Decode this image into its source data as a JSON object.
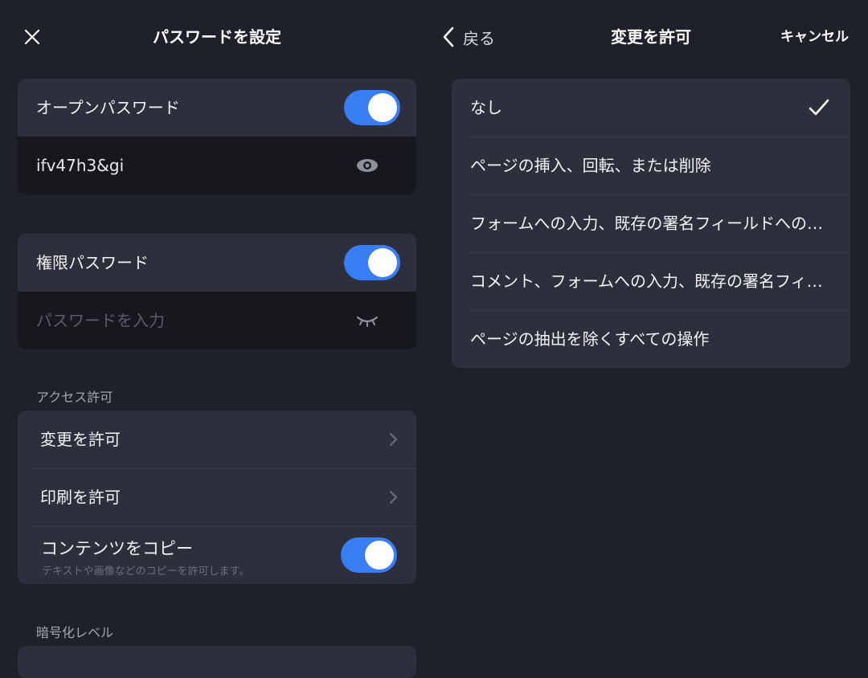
{
  "left": {
    "title": "パスワードを設定",
    "open_password": {
      "label": "オープンパスワード",
      "enabled": true,
      "value": "ifv47h3&gi"
    },
    "permission_password": {
      "label": "権限パスワード",
      "enabled": true,
      "placeholder": "パスワードを入力"
    },
    "access": {
      "section_label": "アクセス許可",
      "allow_changes_label": "変更を許可",
      "allow_printing_label": "印刷を許可",
      "copy_content": {
        "label": "コンテンツをコピー",
        "description": "テキストや画像などのコピーを許可します。",
        "enabled": true
      }
    },
    "encryption_section_label": "暗号化レベル"
  },
  "right": {
    "back_label": "戻る",
    "title": "変更を許可",
    "cancel_label": "キャンセル",
    "options": [
      {
        "label": "なし",
        "selected": true
      },
      {
        "label": "ページの挿入、回転、または削除",
        "selected": false
      },
      {
        "label": "フォームへの入力、既存の署名フィールドへの署名",
        "selected": false
      },
      {
        "label": "コメント、フォームへの入力、既存の署名フィールドへの署名",
        "selected": false
      },
      {
        "label": "ページの抽出を除くすべての操作",
        "selected": false
      }
    ]
  },
  "colors": {
    "background": "#1f212a",
    "card": "#2d2f3c",
    "input_row": "#17181e",
    "accent": "#3a7ef6",
    "section_text": "#a3a5b1"
  },
  "icons": {
    "close": "close-icon",
    "back": "chevron-left-icon",
    "show_password": "eye-icon",
    "hide_password": "eye-closed-icon",
    "disclosure": "chevron-right-icon",
    "selected": "checkmark-icon"
  }
}
